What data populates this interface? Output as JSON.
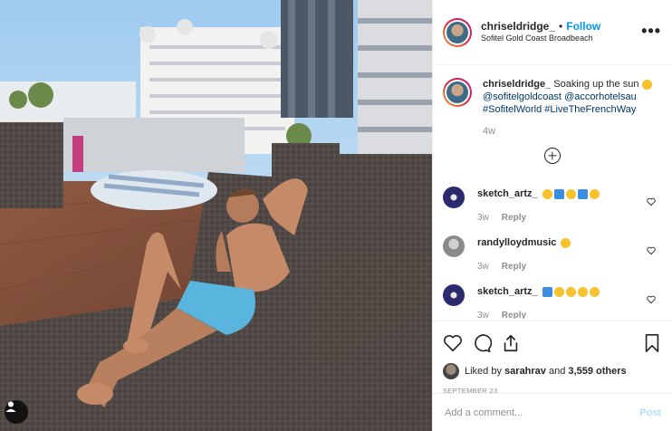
{
  "header": {
    "username": "chriseldridge_",
    "separator": "•",
    "follow_label": "Follow",
    "location": "Sofitel Gold Coast Broadbeach",
    "more_icon": "more-horizontal-icon",
    "more_label": "•••"
  },
  "caption": {
    "username": "chriseldridge_",
    "text": "Soaking up the sun",
    "mention1": "@sofitelgoldcoast",
    "mention2": "@accorhotelsau",
    "hashtag1": "#SofitelWorld",
    "hashtag2": "#LiveTheFrenchWay",
    "time": "4w"
  },
  "comments": [
    {
      "username": "sketch_artz_",
      "time": "3w",
      "reply_label": "Reply",
      "avatar_color": "#2b2a6e"
    },
    {
      "username": "randylloydmusic",
      "time": "3w",
      "reply_label": "Reply",
      "avatar_color": "#9a9a9a"
    },
    {
      "username": "sketch_artz_",
      "time": "3w",
      "reply_label": "Reply",
      "avatar_color": "#2b2a6e"
    }
  ],
  "actions": {
    "like_icon": "heart-icon",
    "comment_icon": "comment-icon",
    "share_icon": "share-icon",
    "save_icon": "bookmark-icon"
  },
  "likes": {
    "prefix": "Liked by",
    "user": "sarahrav",
    "and": "and",
    "others": "3,559 others"
  },
  "date": "SEPTEMBER 23",
  "add_comment": {
    "placeholder": "Add a comment...",
    "post_label": "Post"
  },
  "colors": {
    "accent": "#0095f6",
    "muted": "#8e8e8e",
    "post_disabled": "#b2dffc"
  }
}
